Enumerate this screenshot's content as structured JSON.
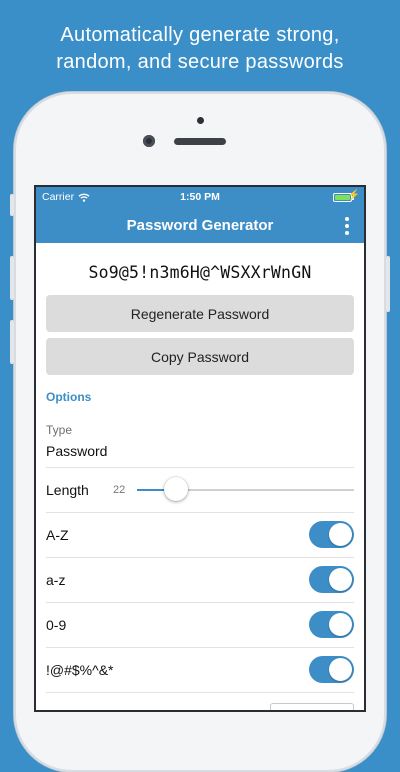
{
  "promo": {
    "line1": "Automatically generate strong,",
    "line2": "random, and secure passwords"
  },
  "status_bar": {
    "carrier": "Carrier",
    "time": "1:50 PM",
    "wifi_icon": "wifi-icon",
    "battery_icon": "battery-icon",
    "charging_icon": "charging-icon"
  },
  "nav": {
    "title": "Password Generator",
    "menu_icon": "more-vertical-icon"
  },
  "generated_password": "So9@5!n3m6H@^WSXXrWnGN",
  "buttons": {
    "regenerate": "Regenerate Password",
    "copy": "Copy Password"
  },
  "options": {
    "section_title": "Options",
    "type_label": "Type",
    "type_value": "Password",
    "length_label": "Length",
    "length_value": "22",
    "length_slider_fraction": 0.18,
    "toggles": [
      {
        "label": "A-Z",
        "on": true
      },
      {
        "label": "a-z",
        "on": true
      },
      {
        "label": "0-9",
        "on": true
      },
      {
        "label": "!@#$%^&*",
        "on": true
      }
    ]
  },
  "colors": {
    "accent": "#3d8ec7",
    "background": "#3a8fc8",
    "battery": "#7be35a"
  }
}
